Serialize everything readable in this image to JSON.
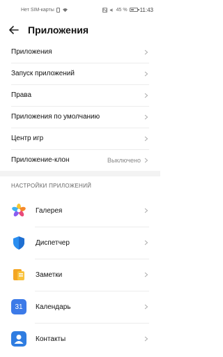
{
  "status_bar": {
    "carrier": "Нет SIM-карты",
    "battery": "45 %",
    "time": "11:43"
  },
  "header": {
    "title": "Приложения"
  },
  "menu": [
    {
      "label": "Приложения",
      "value": ""
    },
    {
      "label": "Запуск приложений",
      "value": ""
    },
    {
      "label": "Права",
      "value": ""
    },
    {
      "label": "Приложения по умолчанию",
      "value": ""
    },
    {
      "label": "Центр игр",
      "value": ""
    },
    {
      "label": "Приложение-клон",
      "value": "Выключено"
    }
  ],
  "section": {
    "title": "НАСТРОЙКИ ПРИЛОЖЕНИЙ"
  },
  "apps": [
    {
      "label": "Галерея",
      "icon": "gallery-icon"
    },
    {
      "label": "Диспетчер",
      "icon": "manager-icon"
    },
    {
      "label": "Заметки",
      "icon": "notes-icon"
    },
    {
      "label": "Календарь",
      "icon": "calendar-icon",
      "icon_text": "31"
    },
    {
      "label": "Контакты",
      "icon": "contacts-icon"
    }
  ]
}
